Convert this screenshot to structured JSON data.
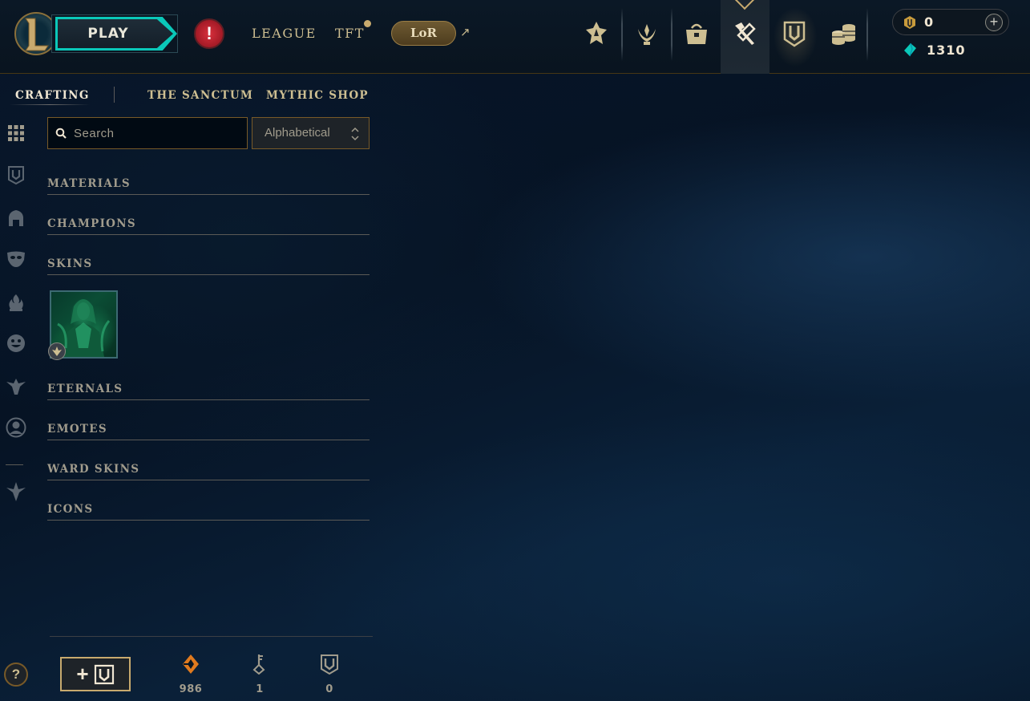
{
  "header": {
    "play_label": "PLAY",
    "alert_symbol": "!",
    "nav": {
      "league": "LEAGUE",
      "tft": "TFT",
      "lor": "LoR",
      "external_symbol": "↗"
    },
    "icons": [
      "lol-logo-icon",
      "alert-icon",
      "ranked-shield-icon",
      "honor-wreath-icon",
      "inventory-bag-icon",
      "crafting-hammer-icon",
      "collection-chest-icon",
      "store-coins-icon"
    ],
    "wallet": {
      "orange_essence": "0",
      "blue_essence": "1310",
      "plus_symbol": "+"
    }
  },
  "subnav": {
    "tabs": [
      {
        "label": "CRAFTING",
        "active": true
      },
      {
        "label": "THE SANCTUM",
        "active": false
      },
      {
        "label": "MYTHIC SHOP",
        "active": false
      }
    ]
  },
  "rail": {
    "icons": [
      "grid-icon",
      "chest-icon",
      "champion-helmet-icon",
      "skin-mask-icon",
      "eternal-flame-icon",
      "emote-face-icon",
      "ward-totem-icon",
      "profile-icon",
      "crest-icon"
    ],
    "help_symbol": "?"
  },
  "search": {
    "placeholder": "Search",
    "value": ""
  },
  "sort": {
    "selected": "Alphabetical"
  },
  "categories": {
    "materials": "MATERIALS",
    "champions": "CHAMPIONS",
    "skins": "SKINS",
    "eternals": "ETERNALS",
    "emotes": "EMOTES",
    "ward_skins": "WARD SKINS",
    "icons": "ICONS"
  },
  "skins": [
    {
      "type": "skin-shard",
      "rarity_icon": "rarity-badge-icon"
    }
  ],
  "footer": {
    "add_chest_symbol": "+",
    "orange_essence": "986",
    "keys": "1",
    "chests": "0"
  },
  "colors": {
    "gold": "#c8aa6e",
    "teal": "#0ac8b9",
    "text": "#cdbe91",
    "muted": "#a09b8c",
    "alert_red": "#d8303c"
  }
}
